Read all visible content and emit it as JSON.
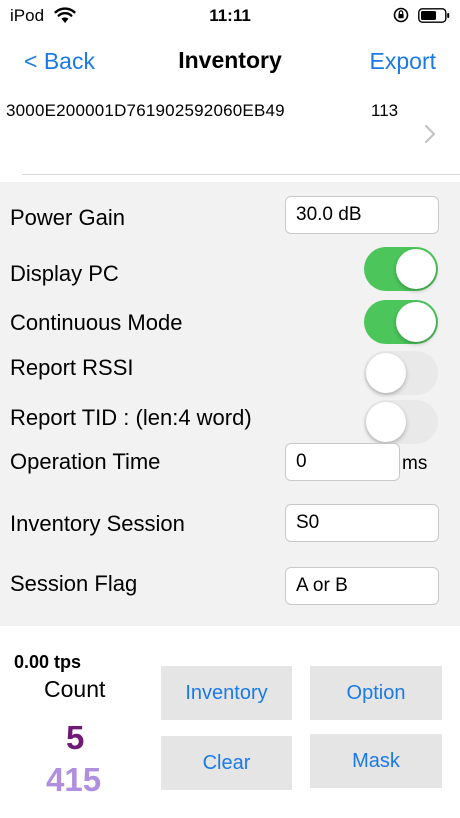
{
  "status_bar": {
    "carrier": "iPod",
    "time": "11:11"
  },
  "nav": {
    "back_label": "< Back",
    "title": "Inventory",
    "export_label": "Export"
  },
  "tags": [
    {
      "epc": "3000E200001D761902592060EB49",
      "count": "113"
    }
  ],
  "settings": {
    "power_gain": {
      "label": "Power Gain",
      "value": "30.0 dB"
    },
    "display_pc": {
      "label": "Display PC",
      "on": true
    },
    "continuous_mode": {
      "label": "Continuous Mode",
      "on": true
    },
    "report_rssi": {
      "label": "Report RSSI",
      "on": false
    },
    "report_tid": {
      "label": "Report TID : (len:4 word)",
      "on": false
    },
    "operation_time": {
      "label": "Operation Time",
      "value": "0",
      "unit": "ms"
    },
    "inventory_session": {
      "label": "Inventory Session",
      "value": "S0"
    },
    "session_flag": {
      "label": "Session Flag",
      "value": "A or B"
    }
  },
  "stats": {
    "tps": "0.00 tps",
    "count_label": "Count",
    "unique_count": "5",
    "total_count": "415"
  },
  "buttons": {
    "inventory": "Inventory",
    "option": "Option",
    "clear": "Clear",
    "mask": "Mask"
  },
  "colors": {
    "accent": "#1a7ae6",
    "toggle_on": "#4cc65a",
    "unique_count": "#6e1a76",
    "total_count": "#b08fe0"
  }
}
